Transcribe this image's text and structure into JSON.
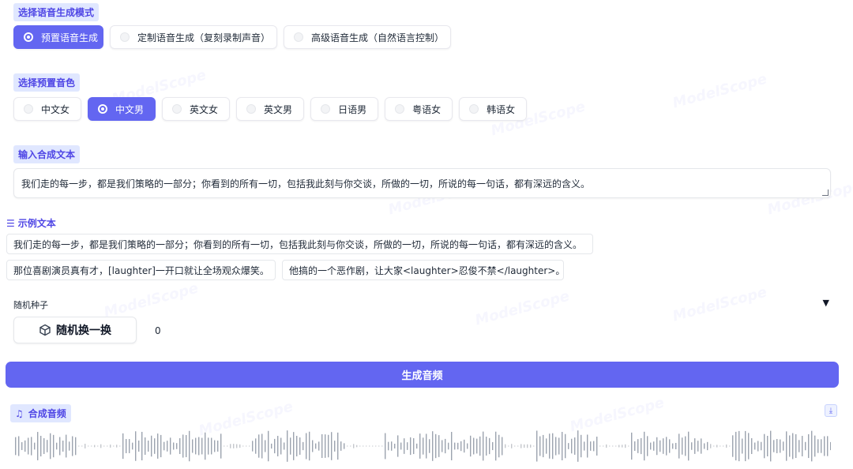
{
  "mode": {
    "label": "选择语音生成模式",
    "options": [
      "预置语音生成",
      "定制语音生成（复刻录制声音）",
      "高级语音生成（自然语言控制）"
    ],
    "selected_index": 0
  },
  "voice": {
    "label": "选择预置音色",
    "options": [
      "中文女",
      "中文男",
      "英文女",
      "英文男",
      "日语男",
      "粤语女",
      "韩语女"
    ],
    "selected_index": 1
  },
  "input": {
    "label": "输入合成文本",
    "value": "我们走的每一步，都是我们策略的一部分；你看到的所有一切，包括我此刻与你交谈，所做的一切，所说的每一句话，都有深远的含义。"
  },
  "examples": {
    "label": "示例文本",
    "items": [
      "我们走的每一步，都是我们策略的一部分；你看到的所有一切，包括我此刻与你交谈，所做的一切，所说的每一句话，都有深远的含义。",
      "那位喜剧演员真有才，[laughter]一开口就让全场观众爆笑。",
      "他搞的一个恶作剧，让大家<laughter>忍俊不禁</laughter>。"
    ]
  },
  "seed": {
    "label": "随机种子",
    "button_label": "随机换一换",
    "value": "0",
    "collapse_glyph": "▼"
  },
  "generate": {
    "label": "生成音频"
  },
  "audio": {
    "label": "合成音频",
    "download_glyph": "⤓"
  },
  "watermark_text": "ModelScope",
  "colors": {
    "accent": "#6366f1",
    "accent_light": "#e0e7ff",
    "accent_text": "#4f46e5"
  }
}
